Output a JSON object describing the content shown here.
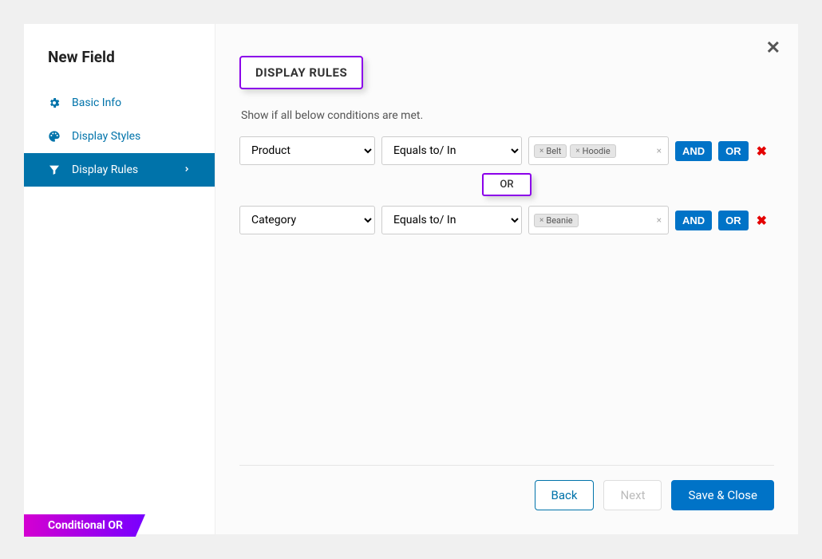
{
  "sidebar": {
    "title": "New Field",
    "items": [
      {
        "label": "Basic Info"
      },
      {
        "label": "Display Styles"
      },
      {
        "label": "Display Rules"
      }
    ],
    "ribbon": "Conditional OR"
  },
  "content": {
    "section_title": "DISPLAY RULES",
    "description": "Show if all below conditions are met.",
    "rules": [
      {
        "field": "Product",
        "operator": "Equals to/ In",
        "tags": [
          "Belt",
          "Hoodie"
        ]
      },
      {
        "field": "Category",
        "operator": "Equals to/ In",
        "tags": [
          "Beanie"
        ]
      }
    ],
    "separator": "OR",
    "buttons": {
      "and": "AND",
      "or": "OR"
    }
  },
  "footer": {
    "back": "Back",
    "next": "Next",
    "save": "Save & Close"
  }
}
